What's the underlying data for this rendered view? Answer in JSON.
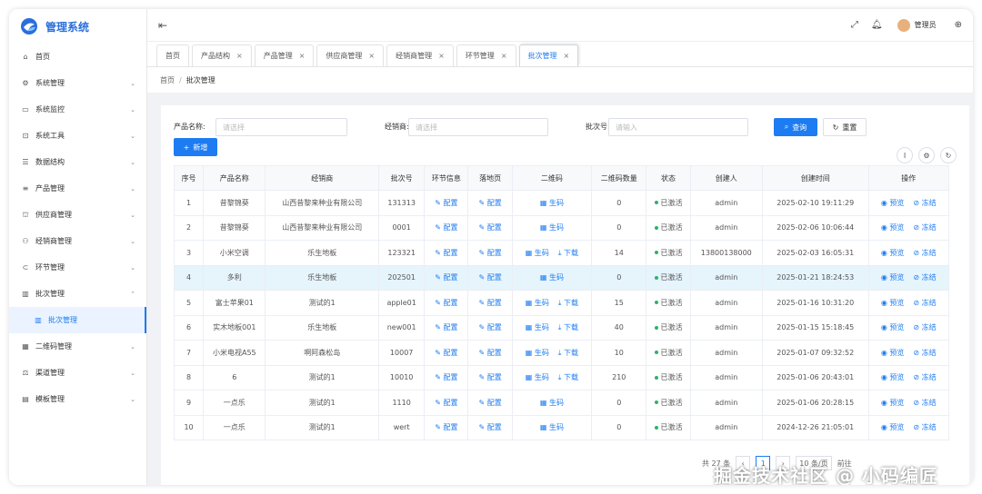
{
  "app": {
    "title": "管理系统"
  },
  "sidebar": {
    "items": [
      {
        "label": "首页",
        "icon": "home-icon",
        "glyph": "⌂",
        "chev": ""
      },
      {
        "label": "系统管理",
        "icon": "gear-icon",
        "glyph": "⚙",
        "chev": "⌄"
      },
      {
        "label": "系统监控",
        "icon": "monitor-icon",
        "glyph": "▭",
        "chev": "⌄"
      },
      {
        "label": "系统工具",
        "icon": "toolbox-icon",
        "glyph": "⊡",
        "chev": "⌄"
      },
      {
        "label": "数据结构",
        "icon": "sliders-icon",
        "glyph": "☰",
        "chev": "⌄"
      },
      {
        "label": "产品管理",
        "icon": "list-icon",
        "glyph": "≡",
        "chev": "⌄"
      },
      {
        "label": "供应商管理",
        "icon": "supplier-icon",
        "glyph": "⛫",
        "chev": "⌄"
      },
      {
        "label": "经销商管理",
        "icon": "dealer-icon",
        "glyph": "⚇",
        "chev": "⌄"
      },
      {
        "label": "环节管理",
        "icon": "link-icon",
        "glyph": "⊂",
        "chev": "⌄"
      },
      {
        "label": "批次管理",
        "icon": "barcode-icon",
        "glyph": "▥",
        "chev": "⌃"
      }
    ],
    "sub_item": {
      "label": "批次管理",
      "icon": "barcode-icon",
      "glyph": "▥"
    },
    "items_after": [
      {
        "label": "二维码管理",
        "icon": "qrcode-icon",
        "glyph": "▦",
        "chev": "⌄"
      },
      {
        "label": "渠道管理",
        "icon": "channel-icon",
        "glyph": "⚖",
        "chev": "⌄"
      },
      {
        "label": "模板管理",
        "icon": "template-icon",
        "glyph": "▤",
        "chev": "⌄"
      }
    ]
  },
  "header": {
    "username": "管理员"
  },
  "tabs": [
    {
      "label": "首页",
      "closable": false,
      "active": false
    },
    {
      "label": "产品结构",
      "closable": true,
      "active": false
    },
    {
      "label": "产品管理",
      "closable": true,
      "active": false
    },
    {
      "label": "供应商管理",
      "closable": true,
      "active": false
    },
    {
      "label": "经销商管理",
      "closable": true,
      "active": false
    },
    {
      "label": "环节管理",
      "closable": true,
      "active": false
    },
    {
      "label": "批次管理",
      "closable": true,
      "active": true
    }
  ],
  "breadcrumb": {
    "home": "首页",
    "current": "批次管理"
  },
  "filters": {
    "product_label": "产品名称:",
    "product_placeholder": "请选择",
    "dealer_label": "经销商:",
    "dealer_placeholder": "请选择",
    "batch_label": "批次号:",
    "batch_placeholder": "请输入",
    "search_label": "查询",
    "reset_label": "重置"
  },
  "add_button": "新增",
  "table": {
    "columns": [
      "序号",
      "产品名称",
      "经销商",
      "批次号",
      "环节信息",
      "落地页",
      "二维码",
      "二维码数量",
      "状态",
      "创建人",
      "创建时间",
      "操作"
    ],
    "rows": [
      {
        "no": "1",
        "product": "昔黎锦葵",
        "dealer": "山西昔黎来种业有限公司",
        "batch": "131313",
        "link": "配置",
        "landing": "配置",
        "qr_gen": "生码",
        "qr_dl": "",
        "qty": "0",
        "status": "已激活",
        "creator": "admin",
        "created": "2025-02-10 19:11:29",
        "view": "预览",
        "freeze": "冻结"
      },
      {
        "no": "2",
        "product": "昔黎锦葵",
        "dealer": "山西昔黎来种业有限公司",
        "batch": "0001",
        "link": "配置",
        "landing": "配置",
        "qr_gen": "生码",
        "qr_dl": "",
        "qty": "0",
        "status": "已激活",
        "creator": "admin",
        "created": "2025-02-06 10:06:44",
        "view": "预览",
        "freeze": "冻结"
      },
      {
        "no": "3",
        "product": "小米空调",
        "dealer": "乐生地板",
        "batch": "123321",
        "link": "配置",
        "landing": "配置",
        "qr_gen": "生码",
        "qr_dl": "下载",
        "qty": "14",
        "status": "已激活",
        "creator": "13800138000",
        "created": "2025-02-03 16:05:31",
        "view": "预览",
        "freeze": "冻结"
      },
      {
        "no": "4",
        "product": "多利",
        "dealer": "乐生地板",
        "batch": "202501",
        "link": "配置",
        "landing": "配置",
        "qr_gen": "生码",
        "qr_dl": "",
        "qty": "0",
        "status": "已激活",
        "creator": "admin",
        "created": "2025-01-21 18:24:53",
        "view": "预览",
        "freeze": "冻结"
      },
      {
        "no": "5",
        "product": "富士苹果01",
        "dealer": "测试的1",
        "batch": "apple01",
        "link": "配置",
        "landing": "配置",
        "qr_gen": "生码",
        "qr_dl": "下载",
        "qty": "15",
        "status": "已激活",
        "creator": "admin",
        "created": "2025-01-16 10:31:20",
        "view": "预览",
        "freeze": "冻结"
      },
      {
        "no": "6",
        "product": "实木地板001",
        "dealer": "乐生地板",
        "batch": "new001",
        "link": "配置",
        "landing": "配置",
        "qr_gen": "生码",
        "qr_dl": "下载",
        "qty": "40",
        "status": "已激活",
        "creator": "admin",
        "created": "2025-01-15 15:18:45",
        "view": "预览",
        "freeze": "冻结"
      },
      {
        "no": "7",
        "product": "小米电视A55",
        "dealer": "啊阿森松岛",
        "batch": "10007",
        "link": "配置",
        "landing": "配置",
        "qr_gen": "生码",
        "qr_dl": "下载",
        "qty": "10",
        "status": "已激活",
        "creator": "admin",
        "created": "2025-01-07 09:32:52",
        "view": "预览",
        "freeze": "冻结"
      },
      {
        "no": "8",
        "product": "6",
        "dealer": "测试的1",
        "batch": "10010",
        "link": "配置",
        "landing": "配置",
        "qr_gen": "生码",
        "qr_dl": "下载",
        "qty": "210",
        "status": "已激活",
        "creator": "admin",
        "created": "2025-01-06 20:43:01",
        "view": "预览",
        "freeze": "冻结"
      },
      {
        "no": "9",
        "product": "一点乐",
        "dealer": "测试的1",
        "batch": "1110",
        "link": "配置",
        "landing": "配置",
        "qr_gen": "生码",
        "qr_dl": "",
        "qty": "0",
        "status": "已激活",
        "creator": "admin",
        "created": "2025-01-06 20:28:15",
        "view": "预览",
        "freeze": "冻结"
      },
      {
        "no": "10",
        "product": "一点乐",
        "dealer": "测试的1",
        "batch": "wert",
        "link": "配置",
        "landing": "配置",
        "qr_gen": "生码",
        "qr_dl": "",
        "qty": "0",
        "status": "已激活",
        "creator": "admin",
        "created": "2024-12-26 21:05:01",
        "view": "预览",
        "freeze": "冻结"
      }
    ],
    "highlighted_row": 3
  },
  "pagination": {
    "total": "共 27 条",
    "page": "1",
    "size": "10 条/页",
    "goto": "前往"
  },
  "watermark": "掘金技术社区 @ 小码编匠",
  "colors": {
    "primary": "#1d7cf2",
    "active_status": "#2ab36b",
    "highlight_row": "#e6f4fc"
  }
}
